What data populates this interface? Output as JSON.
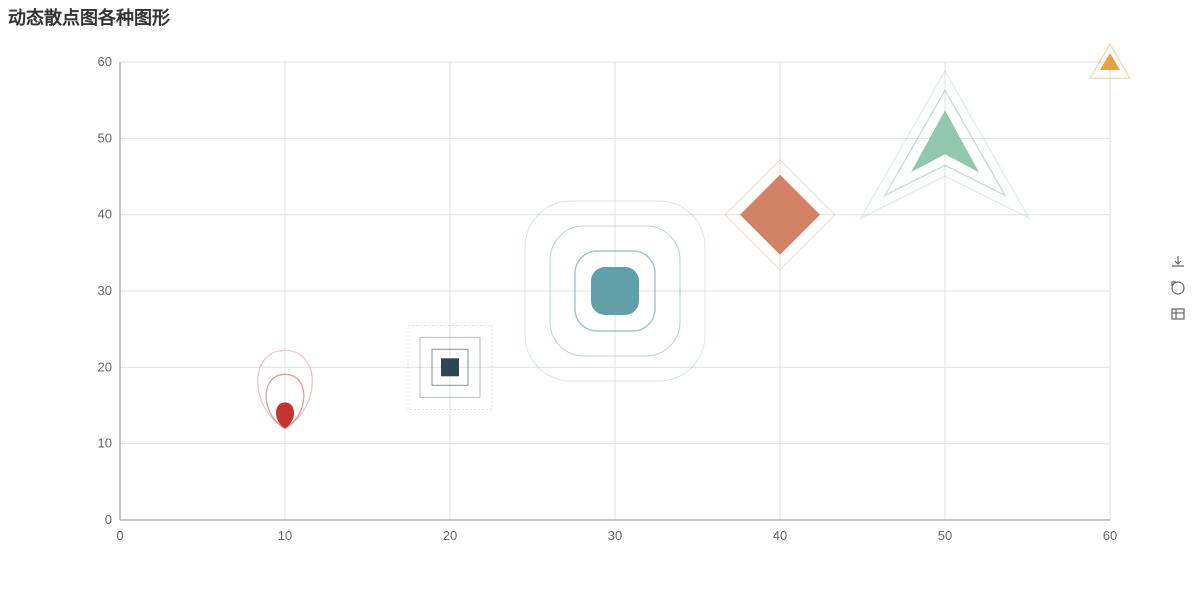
{
  "title": "动态散点图各种图形",
  "chart_data": {
    "type": "scatter",
    "title": "动态散点图各种图形",
    "xlabel": "",
    "ylabel": "",
    "xlim": [
      0,
      60
    ],
    "ylim": [
      0,
      60
    ],
    "xticks": [
      0,
      10,
      20,
      30,
      40,
      50,
      60
    ],
    "yticks": [
      0,
      10,
      20,
      30,
      40,
      50,
      60
    ],
    "grid": true,
    "series": [
      {
        "name": "pin",
        "x": [
          10
        ],
        "y": [
          12
        ],
        "shape": "pin",
        "color": "#c23531"
      },
      {
        "name": "rect",
        "x": [
          20
        ],
        "y": [
          20
        ],
        "shape": "rect",
        "color": "#2f4554"
      },
      {
        "name": "roundRect",
        "x": [
          30
        ],
        "y": [
          30
        ],
        "shape": "roundRect",
        "color": "#61a0a8"
      },
      {
        "name": "diamond",
        "x": [
          40
        ],
        "y": [
          40
        ],
        "shape": "diamond",
        "color": "#d48265"
      },
      {
        "name": "arrow",
        "x": [
          50
        ],
        "y": [
          50
        ],
        "shape": "arrow",
        "color": "#91c7ae"
      },
      {
        "name": "triangle",
        "x": [
          60
        ],
        "y": [
          60
        ],
        "shape": "triangle",
        "color": "#e5a33b"
      }
    ],
    "ripple_effect": true
  },
  "toolbox": {
    "items": [
      {
        "id": "saveAsImage",
        "label": "保存为图片"
      },
      {
        "id": "restore",
        "label": "还原"
      },
      {
        "id": "dataView",
        "label": "数据视图"
      }
    ]
  },
  "colors": {
    "grid": "#e0e0e0",
    "axis": "#888"
  }
}
